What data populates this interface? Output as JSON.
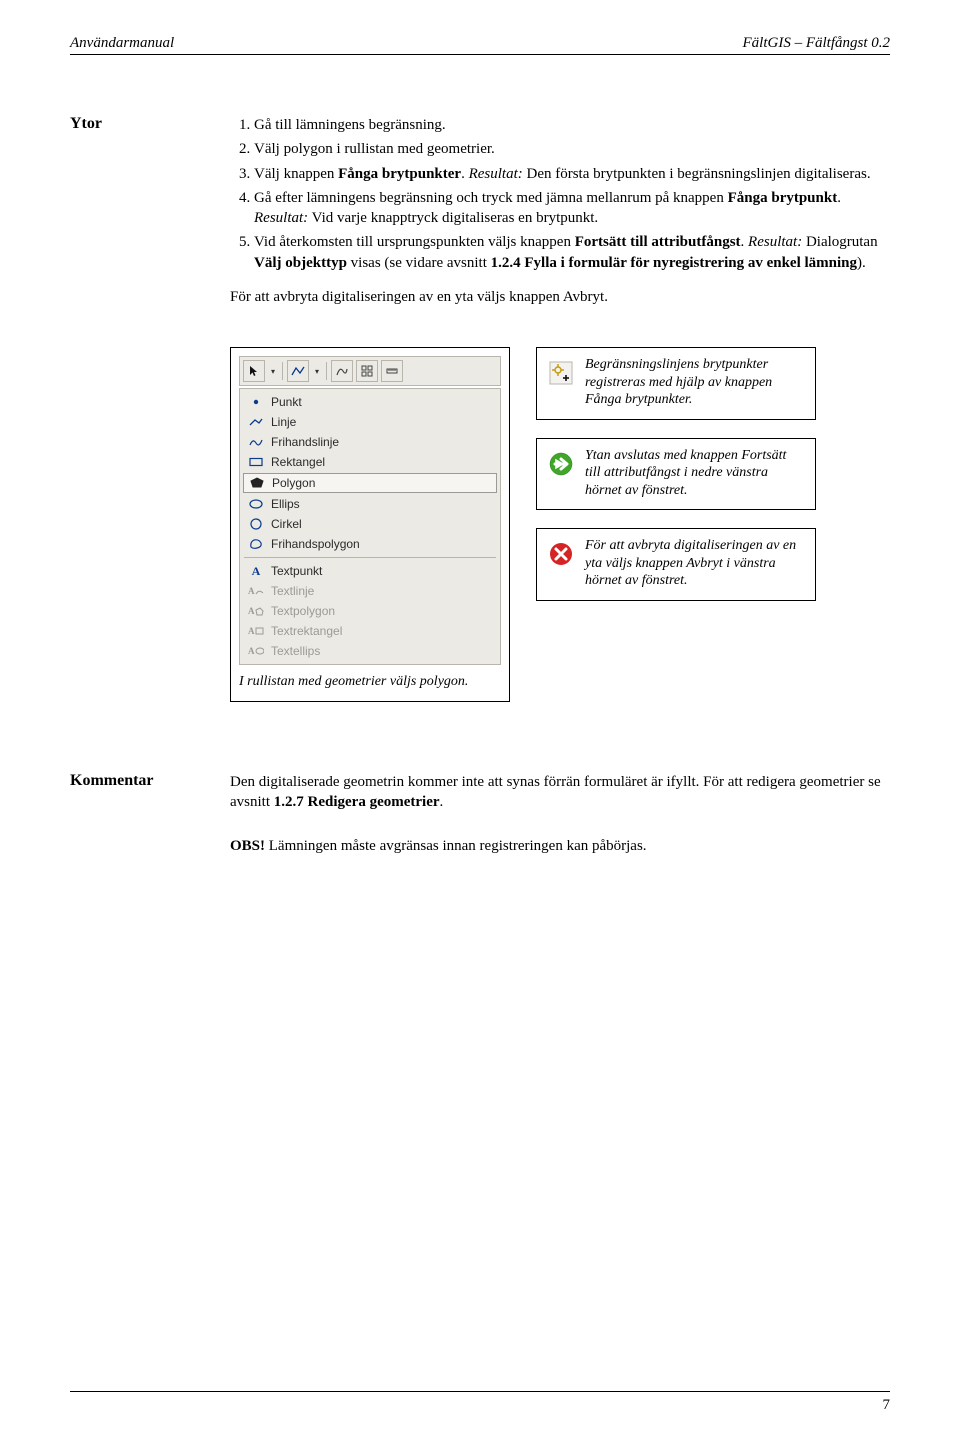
{
  "header": {
    "left": "Användarmanual",
    "right": "FältGIS – Fältfångst 0.2"
  },
  "section_label": "Ytor",
  "steps": {
    "s1": "Gå till lämningens begränsning.",
    "s2": "Välj polygon i rullistan med geometrier.",
    "s3_a": "Välj knappen ",
    "s3_b": "Fånga brytpunkter",
    "s3_c": ". ",
    "s3_d": "Resultat:",
    "s3_e": " Den första brytpunkten i begränsningslinjen digitaliseras.",
    "s4_a": "Gå efter lämningens begränsning och tryck med jämna mellanrum på knappen ",
    "s4_b": "Fånga brytpunkt",
    "s4_c": ". ",
    "s4_d": "Resultat:",
    "s4_e": " Vid varje knapptryck digitaliseras en brytpunkt.",
    "s5_a": "Vid återkomsten till ursprungspunkten väljs knappen ",
    "s5_b": "Fortsätt till attributfångst",
    "s5_c": ". ",
    "s5_d": "Resultat:",
    "s5_e": " Dialogrutan ",
    "s5_f": "Välj objekttyp",
    "s5_g": " visas (se vidare avsnitt ",
    "s5_h": "1.2.4 Fylla i formulär för nyregistrering av enkel lämning",
    "s5_i": ")."
  },
  "after_list": "För att avbryta digitaliseringen av en yta väljs knappen Avbryt.",
  "geom_list": {
    "toolbar": {
      "arrow": "▾"
    },
    "items": {
      "punkt": "Punkt",
      "linje": "Linje",
      "frihandslinje": "Frihandslinje",
      "rektangel": "Rektangel",
      "polygon": "Polygon",
      "ellips": "Ellips",
      "cirkel": "Cirkel",
      "frihandspolygon": "Frihandspolygon",
      "textpunkt": "Textpunkt",
      "textlinje": "Textlinje",
      "textpolygon": "Textpolygon",
      "textrektangel": "Textrektangel",
      "textellips": "Textellips"
    }
  },
  "figure_caption": "I rullistan med geometrier väljs polygon.",
  "info1": "Begränsningslinjens brytpunkter registreras med hjälp av knappen Fånga brytpunkter.",
  "info2": "Ytan avslutas med knappen Fortsätt till attributfångst i nedre vänstra hörnet av fönstret.",
  "info3": "För att avbryta digitaliseringen av en yta väljs knappen Avbryt i vänstra hörnet av fönstret.",
  "comment_label": "Kommentar",
  "comment": {
    "p1_a": "Den digitaliserade geometrin kommer inte att synas förrän formuläret är ifyllt. För att redigera geometrier se avsnitt ",
    "p1_b": "1.2.7 Redigera geometrier",
    "p1_c": ".",
    "p2_a": "OBS!",
    "p2_b": " Lämningen måste avgränsas innan registreringen kan påbörjas."
  },
  "page_number": "7"
}
